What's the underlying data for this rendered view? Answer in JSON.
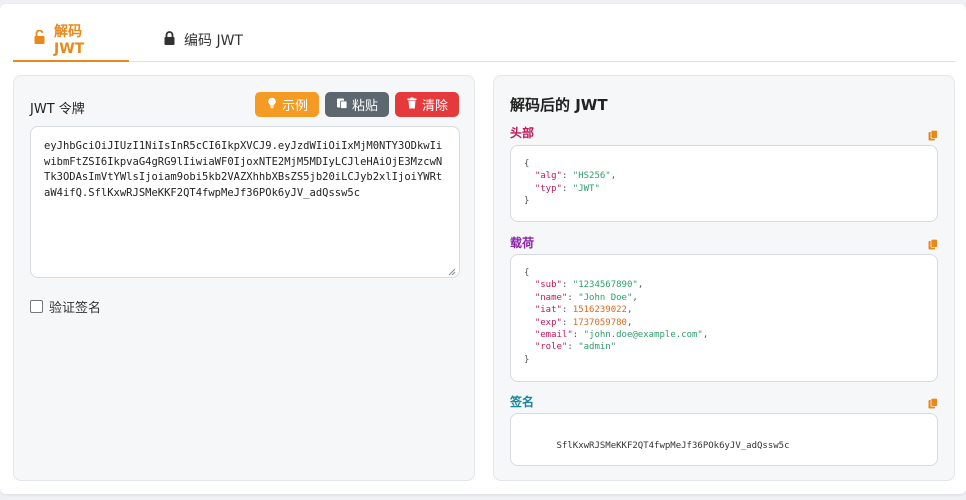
{
  "tabs": [
    {
      "label": "解码 JWT",
      "active": true,
      "icon": "unlock-icon"
    },
    {
      "label": "编码 JWT",
      "active": false,
      "icon": "lock-icon"
    }
  ],
  "left": {
    "token_label": "JWT 令牌",
    "buttons": {
      "example": "示例",
      "paste": "粘贴",
      "clear": "清除"
    },
    "token_value": "eyJhbGciOiJIUzI1NiIsInR5cCI6IkpXVCJ9.eyJzdWIiOiIxMjM0NTY3ODkwIiwibmFtZSI6IkpvaG4gRG9lIiwiaWF0IjoxNTE2MjM5MDIyLCJleHAiOjE3MzcwNTk3ODAsImVtYWlsIjoiam9obi5kb2VAZXhhbXBsZS5jb20iLCJyb2xlIjoiYWRtaW4ifQ.SflKxwRJSMeKKF2QT4fwpMeJf36POk6yJV_adQssw5c",
    "verify_label": "验证签名",
    "verify_checked": false
  },
  "right": {
    "title": "解码后的 JWT",
    "header": {
      "label": "头部",
      "color": "#c2185b",
      "fields": [
        {
          "key": "alg",
          "value": "HS256",
          "type": "string"
        },
        {
          "key": "typ",
          "value": "JWT",
          "type": "string"
        }
      ]
    },
    "payload": {
      "label": "载荷",
      "color": "#8e24aa",
      "fields": [
        {
          "key": "sub",
          "value": "1234567890",
          "type": "string"
        },
        {
          "key": "name",
          "value": "John Doe",
          "type": "string"
        },
        {
          "key": "iat",
          "value": "1516239022",
          "type": "number"
        },
        {
          "key": "exp",
          "value": "1737059780",
          "type": "number"
        },
        {
          "key": "email",
          "value": "john.doe@example.com",
          "type": "string"
        },
        {
          "key": "role",
          "value": "admin",
          "type": "string"
        }
      ]
    },
    "signature": {
      "label": "签名",
      "color": "#17879b",
      "value": "SflKxwRJSMeKKF2QT4fwpMeJf36POk6yJV_adQssw5c"
    }
  },
  "colors": {
    "accent": "#e8891a",
    "example_button": "#f59a23",
    "paste_button": "#5c6770",
    "clear_button": "#e5393b",
    "copy_icon": "#e8891a"
  }
}
